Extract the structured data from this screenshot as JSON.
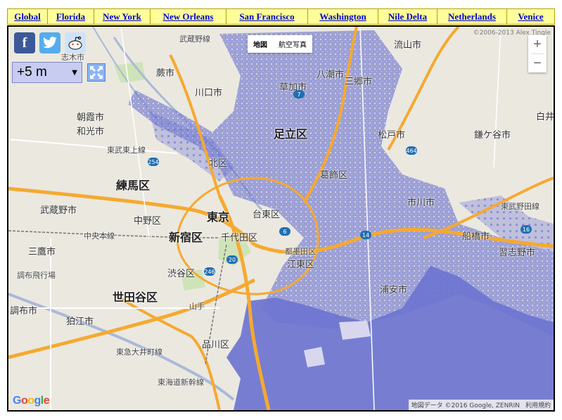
{
  "tabs": [
    {
      "label": "Global",
      "width": 58
    },
    {
      "label": "Florida",
      "width": 66
    },
    {
      "label": "New York",
      "width": 80
    },
    {
      "label": "New Orleans",
      "width": 108
    },
    {
      "label": "San Francisco",
      "width": 116
    },
    {
      "label": "Washington",
      "width": 100
    },
    {
      "label": "Nile Delta",
      "width": 84
    },
    {
      "label": "Netherlands",
      "width": 99
    },
    {
      "label": "Venice",
      "width": 68
    }
  ],
  "social": {
    "facebook": "f",
    "twitter": "t",
    "reddit": "reddit-icon"
  },
  "sea_level": {
    "value": "+5 m"
  },
  "map_type": {
    "map": "地図",
    "satellite": "航空写真"
  },
  "zoom": {
    "in": "+",
    "out": "−"
  },
  "copyright": "©2006-2013 Alex Tingle",
  "attribution": {
    "data": "地図データ ©2016 Google, ZENRIN",
    "terms": "利用規約"
  },
  "google_logo": {
    "G": "G",
    "o1": "o",
    "o2": "o",
    "g": "g",
    "l": "l",
    "e": "e"
  },
  "colors": {
    "flood": "#6c74d0",
    "land": "#ebe8e0",
    "highway": "#f6a930",
    "road": "#ffffff",
    "river": "#aab9d8",
    "tab_bg": "#ffff99"
  },
  "places": {
    "adachi": "足立区",
    "katsushika": "葛飾区",
    "kita": "北区",
    "nerima": "練馬区",
    "tokyo": "東京",
    "shinjuku": "新宿区",
    "chiyoda": "千代田区",
    "taito": "台東区",
    "setagaya": "世田谷区",
    "koto": "江東区",
    "sumida": "都墨田区",
    "shibuya": "渋谷区",
    "shinagawa": "品川区",
    "nakano": "中野区",
    "warabi": "蕨市",
    "kawaguchi": "川口市",
    "soka": "草加市",
    "yashio": "八潮市",
    "misato": "三郷市",
    "matsudo": "松戸市",
    "ichikawa": "市川市",
    "funabashi": "船橋市",
    "urayasu": "浦安市",
    "narashino": "習志野市",
    "kamagaya": "鎌ケ谷市",
    "nagareyama": "流山市",
    "asaka": "朝霞市",
    "wako": "和光市",
    "mitaka": "三鷹市",
    "chofu": "調布市",
    "komae": "狛江市",
    "musashino": "武蔵野市",
    "shiroi": "白井市",
    "chofu_air": "調布飛行場",
    "tobu_tojo": "東武東上線",
    "musashino_line": "武蔵野線",
    "chuo_line": "中央本線",
    "tokaido_shinkansen": "東海道新幹線",
    "toei_oimachi": "東急大井町線",
    "tobu_line": "東武野田線",
    "yamate": "山手",
    "shishi": "志木市",
    "route_7": "7",
    "route_254": "254",
    "route_246": "246",
    "route_20": "20",
    "route_6": "6",
    "route_464": "464",
    "route_14": "14",
    "route_16": "16"
  }
}
